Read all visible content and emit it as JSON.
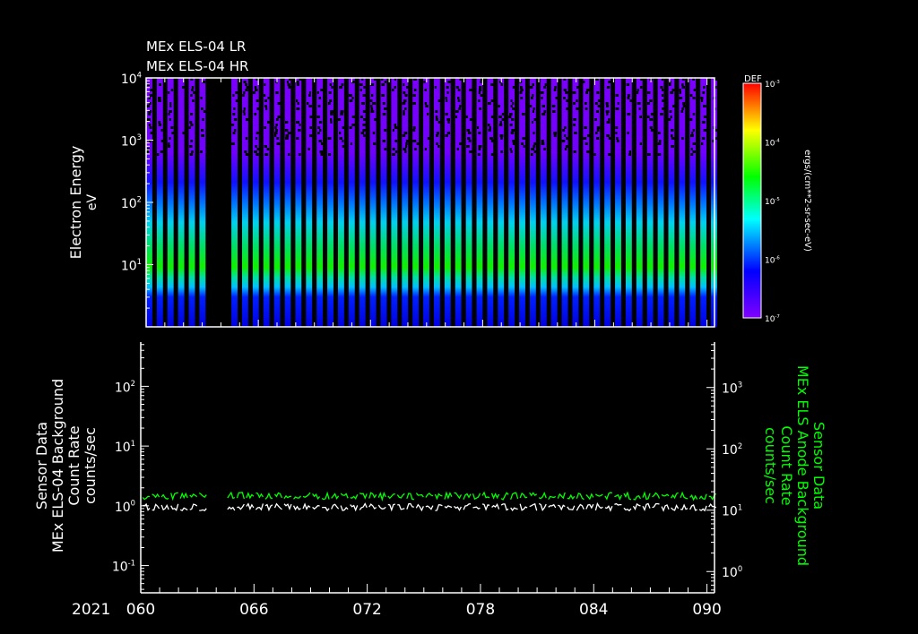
{
  "chart_data": [
    {
      "type": "heatmap",
      "title_lines": [
        "MEx ELS-04 LR",
        "MEx ELS-04 HR"
      ],
      "ylabel": "Electron Energy",
      "yunit": "eV",
      "yscale": "log",
      "ylim": [
        1,
        10000
      ],
      "yticks": [
        {
          "v": 10,
          "label": "10",
          "exp": "1"
        },
        {
          "v": 100,
          "label": "10",
          "exp": "2"
        },
        {
          "v": 1000,
          "label": "10",
          "exp": "3"
        },
        {
          "v": 10000,
          "label": "10",
          "exp": "4"
        }
      ],
      "xlim": [
        60,
        90.4
      ],
      "stripes": {
        "start_day": 60.0,
        "period_days": 0.57,
        "width_days": 0.33,
        "data_gap": [
          63.4,
          64.2
        ]
      },
      "colorbar": {
        "title": "DEF",
        "label": "ergs/(cm**2-sr-sec-eV)",
        "scale": "log",
        "range": [
          1e-07,
          0.001
        ],
        "ticks": [
          {
            "label": "10",
            "exp": "-7"
          },
          {
            "label": "10",
            "exp": "-6"
          },
          {
            "label": "10",
            "exp": "-5"
          },
          {
            "label": "10",
            "exp": "-4"
          },
          {
            "label": "10",
            "exp": "-3"
          }
        ],
        "colors": [
          "#8000ff",
          "#0000ff",
          "#00ffff",
          "#00ff00",
          "#ffff00",
          "#ff0000"
        ]
      }
    },
    {
      "type": "line",
      "ylabel_left": [
        "Sensor Data",
        "MEx ELS-04 Background",
        "Count Rate",
        "counts/sec"
      ],
      "ylabel_right": [
        "Sensor Data",
        "MEx ELS Anode Background",
        "Count Rate",
        "counts/sec"
      ],
      "left_yscale": "log",
      "left_ylim": [
        0.035,
        550
      ],
      "left_yticks": [
        {
          "v": 0.1,
          "label": "10",
          "exp": "-1"
        },
        {
          "v": 1,
          "label": "10",
          "exp": "0"
        },
        {
          "v": 10,
          "label": "10",
          "exp": "1"
        },
        {
          "v": 100,
          "label": "10",
          "exp": "2"
        }
      ],
      "right_yscale": "log",
      "right_ylim": [
        0.45,
        5500
      ],
      "right_yticks": [
        {
          "v": 1,
          "label": "10",
          "exp": "0"
        },
        {
          "v": 10,
          "label": "10",
          "exp": "1"
        },
        {
          "v": 100,
          "label": "10",
          "exp": "2"
        },
        {
          "v": 1000,
          "label": "10",
          "exp": "3"
        }
      ],
      "series": [
        {
          "name": "MEx ELS-04 Background Count Rate",
          "axis": "left",
          "color": "#ffffff",
          "typical_value": 0.95
        },
        {
          "name": "MEx ELS Anode Background Count Rate",
          "axis": "right",
          "color": "#00ff00",
          "typical_value": 17
        }
      ],
      "sample_period_days": 1.0,
      "data_gap": [
        63.4,
        64.2
      ]
    }
  ],
  "xaxis": {
    "year": "2021",
    "ticks": [
      {
        "v": 60,
        "label": "060"
      },
      {
        "v": 66,
        "label": "066"
      },
      {
        "v": 72,
        "label": "072"
      },
      {
        "v": 78,
        "label": "078"
      },
      {
        "v": 84,
        "label": "084"
      },
      {
        "v": 90,
        "label": "090"
      }
    ]
  }
}
